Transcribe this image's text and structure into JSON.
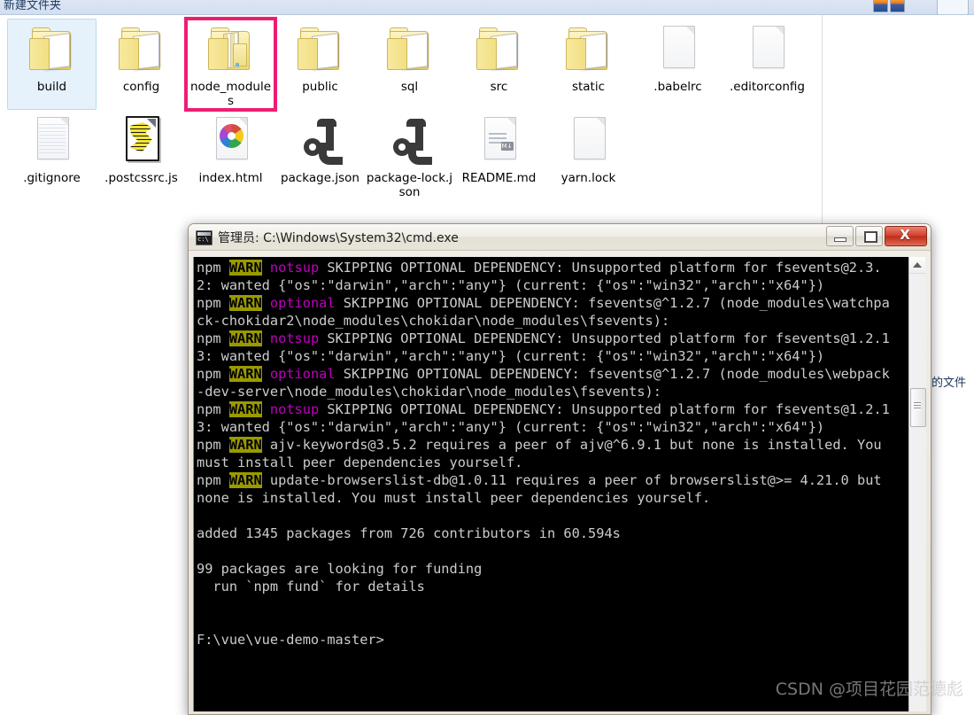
{
  "explorer": {
    "title": "新建文件夹",
    "status_text": "的文件",
    "toolbar_icon_1": "thumbnail-view-icon",
    "toolbar_icon_2": "details-view-icon",
    "items": [
      {
        "label": "build",
        "icon": "folder-icon",
        "selected": true,
        "highlighted": false
      },
      {
        "label": "config",
        "icon": "folder-icon",
        "selected": false,
        "highlighted": false
      },
      {
        "label": "node_modules",
        "icon": "folder-full-icon",
        "selected": false,
        "highlighted": true
      },
      {
        "label": "public",
        "icon": "folder-icon",
        "selected": false,
        "highlighted": false
      },
      {
        "label": "sql",
        "icon": "folder-icon",
        "selected": false,
        "highlighted": false
      },
      {
        "label": "src",
        "icon": "folder-icon",
        "selected": false,
        "highlighted": false
      },
      {
        "label": "static",
        "icon": "folder-icon",
        "selected": false,
        "highlighted": false
      },
      {
        "label": ".babelrc",
        "icon": "blank-file-icon",
        "selected": false,
        "highlighted": false
      },
      {
        "label": ".editorconfig",
        "icon": "blank-file-icon",
        "selected": false,
        "highlighted": false
      },
      {
        "label": ".gitignore",
        "icon": "text-file-icon",
        "selected": false,
        "highlighted": false
      },
      {
        "label": ".postcssrc.js",
        "icon": "script-file-icon",
        "selected": false,
        "highlighted": false
      },
      {
        "label": "index.html",
        "icon": "chrome-html-icon",
        "selected": false,
        "highlighted": false
      },
      {
        "label": "package.json",
        "icon": "json-file-icon",
        "selected": false,
        "highlighted": false
      },
      {
        "label": "package-lock.json",
        "icon": "json-file-icon",
        "selected": false,
        "highlighted": false
      },
      {
        "label": "README.md",
        "icon": "markdown-file-icon",
        "selected": false,
        "highlighted": false
      },
      {
        "label": "yarn.lock",
        "icon": "blank-file-icon",
        "selected": false,
        "highlighted": false
      }
    ],
    "highlight_color": "#ee1d74",
    "selection_color": "#e5f1fb"
  },
  "cmd_window": {
    "title": "管理员: C:\\Windows\\System32\\cmd.exe",
    "icon": "cmd-console-icon",
    "buttons": {
      "minimize": "minimize-button",
      "maximize": "maximize-button",
      "close": "X"
    },
    "console": {
      "foreground_color": "#cccccc",
      "background_color": "#000000",
      "warn_background": "#9a9a00",
      "accent_color": "#c000c0",
      "lines": [
        {
          "segments": [
            {
              "text": "npm ",
              "style": "normal"
            },
            {
              "text": "WARN",
              "style": "warn"
            },
            {
              "text": " ",
              "style": "normal"
            },
            {
              "text": "notsup",
              "style": "magenta"
            },
            {
              "text": " SKIPPING OPTIONAL DEPENDENCY: Unsupported platform for fsevents@2.3.2: wanted {\"os\":\"darwin\",\"arch\":\"any\"} (current: {\"os\":\"win32\",\"arch\":\"x64\"})",
              "style": "normal"
            }
          ]
        },
        {
          "segments": [
            {
              "text": "npm ",
              "style": "normal"
            },
            {
              "text": "WARN",
              "style": "warn"
            },
            {
              "text": " ",
              "style": "normal"
            },
            {
              "text": "optional",
              "style": "magenta"
            },
            {
              "text": " SKIPPING OPTIONAL DEPENDENCY: fsevents@^1.2.7 (node_modules\\watchpack-chokidar2\\node_modules\\chokidar\\node_modules\\fsevents):",
              "style": "normal"
            }
          ]
        },
        {
          "segments": [
            {
              "text": "npm ",
              "style": "normal"
            },
            {
              "text": "WARN",
              "style": "warn"
            },
            {
              "text": " ",
              "style": "normal"
            },
            {
              "text": "notsup",
              "style": "magenta"
            },
            {
              "text": " SKIPPING OPTIONAL DEPENDENCY: Unsupported platform for fsevents@1.2.13: wanted {\"os\":\"darwin\",\"arch\":\"any\"} (current: {\"os\":\"win32\",\"arch\":\"x64\"})",
              "style": "normal"
            }
          ]
        },
        {
          "segments": [
            {
              "text": "npm ",
              "style": "normal"
            },
            {
              "text": "WARN",
              "style": "warn"
            },
            {
              "text": " ",
              "style": "normal"
            },
            {
              "text": "optional",
              "style": "magenta"
            },
            {
              "text": " SKIPPING OPTIONAL DEPENDENCY: fsevents@^1.2.7 (node_modules\\webpack-dev-server\\node_modules\\chokidar\\node_modules\\fsevents):",
              "style": "normal"
            }
          ]
        },
        {
          "segments": [
            {
              "text": "npm ",
              "style": "normal"
            },
            {
              "text": "WARN",
              "style": "warn"
            },
            {
              "text": " ",
              "style": "normal"
            },
            {
              "text": "notsup",
              "style": "magenta"
            },
            {
              "text": " SKIPPING OPTIONAL DEPENDENCY: Unsupported platform for fsevents@1.2.13: wanted {\"os\":\"darwin\",\"arch\":\"any\"} (current: {\"os\":\"win32\",\"arch\":\"x64\"})",
              "style": "normal"
            }
          ]
        },
        {
          "segments": [
            {
              "text": "npm ",
              "style": "normal"
            },
            {
              "text": "WARN",
              "style": "warn"
            },
            {
              "text": " ajv-keywords@3.5.2 requires a peer of ajv@^6.9.1 but none is installed. You must install peer dependencies yourself.",
              "style": "normal"
            }
          ]
        },
        {
          "segments": [
            {
              "text": "npm ",
              "style": "normal"
            },
            {
              "text": "WARN",
              "style": "warn"
            },
            {
              "text": " update-browserslist-db@1.0.11 requires a peer of browserslist@>= 4.21.0 but none is installed. You must install peer dependencies yourself.",
              "style": "normal"
            }
          ]
        },
        {
          "segments": [
            {
              "text": "",
              "style": "normal"
            }
          ]
        },
        {
          "segments": [
            {
              "text": "added 1345 packages from 726 contributors in 60.594s",
              "style": "normal"
            }
          ]
        },
        {
          "segments": [
            {
              "text": "",
              "style": "normal"
            }
          ]
        },
        {
          "segments": [
            {
              "text": "99 packages are looking for funding",
              "style": "normal"
            }
          ]
        },
        {
          "segments": [
            {
              "text": "  run `npm fund` for details",
              "style": "normal"
            }
          ]
        },
        {
          "segments": [
            {
              "text": "",
              "style": "normal"
            }
          ]
        },
        {
          "segments": [
            {
              "text": "",
              "style": "normal"
            }
          ]
        },
        {
          "segments": [
            {
              "text": "F:\\vue\\vue-demo-master>",
              "style": "normal"
            }
          ]
        }
      ]
    }
  },
  "watermark": "CSDN @项目花园范德彪"
}
